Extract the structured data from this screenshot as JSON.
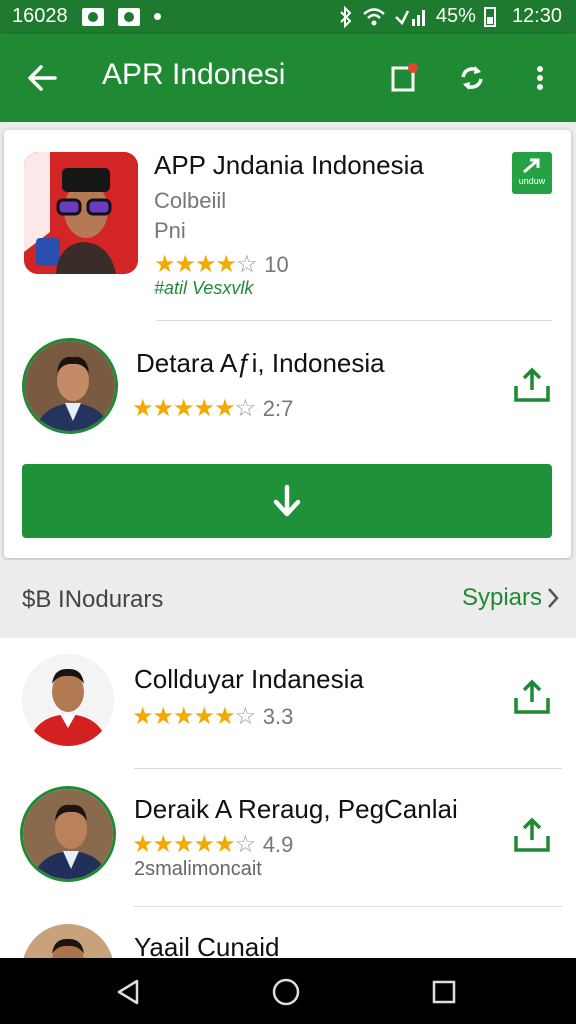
{
  "status_bar": {
    "left_text": "16028",
    "battery_text": "45%",
    "time": "12:30"
  },
  "app_bar": {
    "title": "APR Indonesi"
  },
  "featured": {
    "name": "APP Jndania Indonesia",
    "developer": "Colbeiil",
    "category": "Pni",
    "rating_text": "10",
    "rating_stars": 4,
    "tag": "#atil Vesxvlk",
    "badge_label": "unduw"
  },
  "secondary": {
    "name": "Detara Aƒi, Indonesia",
    "rating_text": "2:7",
    "rating_stars": 4
  },
  "section": {
    "title": "$B INodurars",
    "action": "Sypiars"
  },
  "list": [
    {
      "name": "Collduyar Indanesia",
      "rating_text": "3.3",
      "subtitle": ""
    },
    {
      "name": "Deraik A Reraug, PegCanlai",
      "rating_text": "4.9",
      "subtitle": "2smalimoncait"
    },
    {
      "name": "Yaail Cunaid",
      "rating_text": "",
      "subtitle": ""
    }
  ],
  "colors": {
    "status_bar": "#1e7a2e",
    "app_bar": "#1f8a33",
    "accent_green": "#1f9138",
    "star": "#f2a900"
  }
}
